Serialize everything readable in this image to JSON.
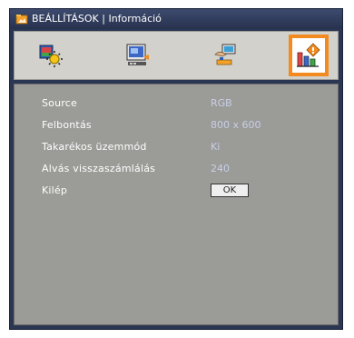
{
  "window": {
    "title": "BEÁLLÍTÁSOK | Információ",
    "title_icon": "settings-folder-icon"
  },
  "tabs": [
    {
      "icon": "image-sun-icon",
      "active": false
    },
    {
      "icon": "display-screen-icon",
      "active": false
    },
    {
      "icon": "hand-settings-icon",
      "active": false
    },
    {
      "icon": "info-chart-icon",
      "active": true
    }
  ],
  "info_rows": [
    {
      "label": "Source",
      "value": "RGB"
    },
    {
      "label": "Felbontás",
      "value": "800 x 600"
    },
    {
      "label": "Takarékos üzemmód",
      "value": "Ki"
    },
    {
      "label": "Alvás visszaszámlálás",
      "value": "240"
    }
  ],
  "exit": {
    "label": "Kilép",
    "button_label": "OK"
  },
  "colors": {
    "frame": "#2b3652",
    "panel": "#9b9b98",
    "active_tab_border": "#f28a1f",
    "value_text": "#c8cfe6"
  }
}
